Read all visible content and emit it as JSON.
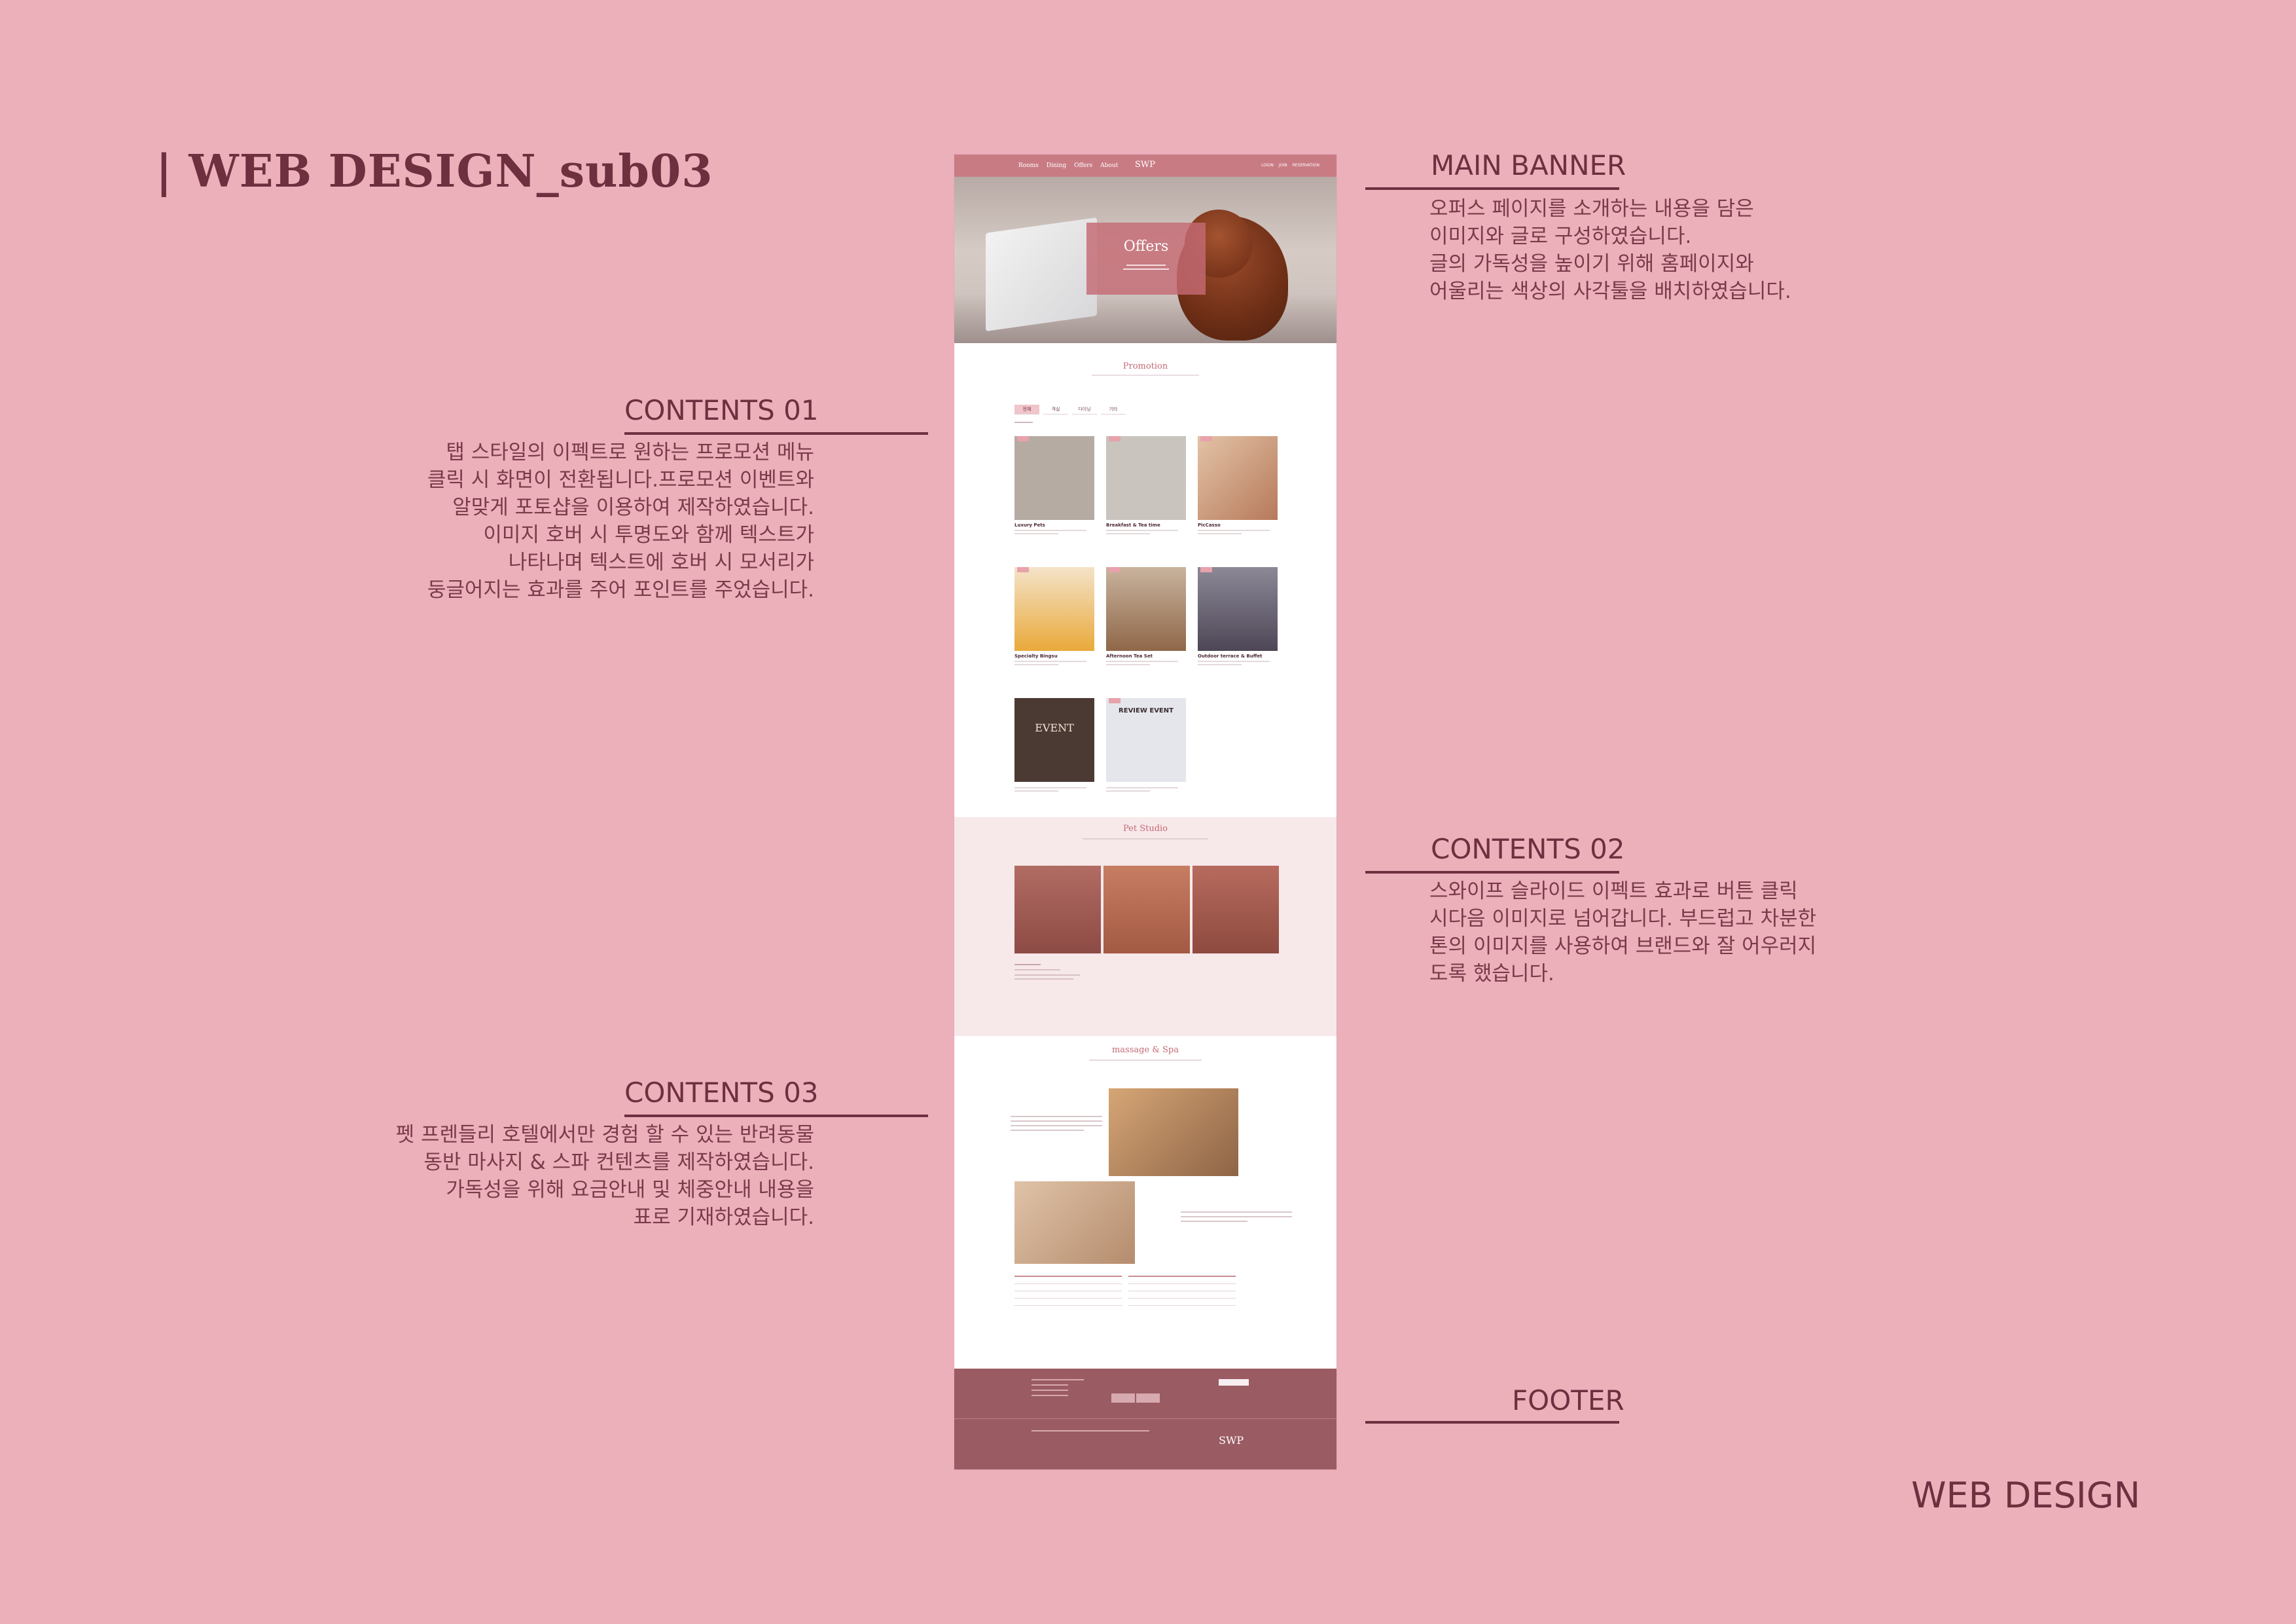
{
  "board": {
    "title": "| WEB  DESIGN_sub03",
    "footer_word": "WEB DESIGN"
  },
  "notes": {
    "main_banner": {
      "title": "MAIN BANNER",
      "lines": [
        "오퍼스 페이지를 소개하는 내용을 담은",
        "이미지와 글로 구성하였습니다.",
        "글의 가독성을 높이기 위해 홈페이지와",
        "어울리는 색상의 사각툴을 배치하였습니다."
      ]
    },
    "contents01": {
      "title": "CONTENTS 01",
      "lines": [
        "탭 스타일의 이펙트로 원하는 프로모션 메뉴",
        "클릭 시 화면이 전환됩니다.프로모션 이벤트와",
        "알맞게 포토샵을 이용하여 제작하였습니다.",
        "이미지 호버 시 투명도와 함께 텍스트가",
        "나타나며 텍스트에 호버 시 모서리가",
        "둥글어지는 효과를 주어 포인트를 주었습니다."
      ]
    },
    "contents02": {
      "title": "CONTENTS 02",
      "lines": [
        "스와이프 슬라이드 이펙트 효과로 버튼 클릭",
        "시다음 이미지로 넘어갑니다. 부드럽고 차분한",
        "톤의 이미지를 사용하여 브랜드와 잘 어우러지",
        "도록 했습니다."
      ]
    },
    "contents03": {
      "title": "CONTENTS 03",
      "lines": [
        "펫 프렌들리 호텔에서만 경험 할 수 있는 반려동물",
        "동반 마사지 & 스파 컨텐츠를 제작하였습니다.",
        "가독성을 위해 요금안내 및 체중안내 내용을",
        "표로 기재하였습니다."
      ]
    },
    "footer": {
      "title": "FOOTER"
    }
  },
  "mockup": {
    "nav": {
      "items": [
        "Rooms",
        "Dining",
        "Offers",
        "About"
      ],
      "logo": "SWP",
      "util": [
        "LOGIN",
        "JOIN",
        "RESERVATION"
      ]
    },
    "hero": {
      "title": "Offers"
    },
    "promotion": {
      "title": "Promotion",
      "tabs": [
        "전체",
        "객실",
        "다이닝",
        "기타"
      ],
      "cards": [
        {
          "title": "Luxury Pets",
          "color": "#b5aba3"
        },
        {
          "title": "Breakfast & Tea time",
          "color": "#c9c4bd"
        },
        {
          "title": "PicCasso",
          "color": "#c9a58f"
        },
        {
          "title": "Specialty Bingsu",
          "color": "#e7b24a"
        },
        {
          "title": "Afternoon Tea Set",
          "color": "#b6906f"
        },
        {
          "title": "Outdoor terrace & Buffet",
          "color": "#6d6470"
        },
        {
          "title": "EVENT",
          "color": "#4b3a33"
        },
        {
          "title": "REVIEW EVENT",
          "color": "#e4e6ec"
        }
      ]
    },
    "pet_studio": {
      "title": "Pet Studio"
    },
    "spa": {
      "title": "massage & Spa"
    },
    "footer": {
      "logo": "SWP"
    }
  }
}
